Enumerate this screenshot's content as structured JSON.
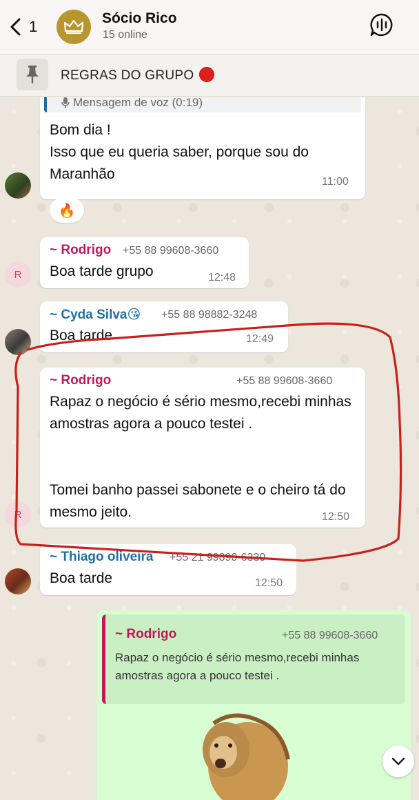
{
  "header": {
    "back_count": "1",
    "group_name": "Sócio Rico",
    "group_status": "15 online"
  },
  "pinned": {
    "label": "REGRAS DO GRUPO"
  },
  "messages": [
    {
      "quoted_preview": "Mensagem de voz (0:19)",
      "text": "Bom dia !\nIsso que eu queria saber, porque sou do Maranhão",
      "time": "11:00",
      "reaction": "🔥"
    },
    {
      "sender": "~ Rodrigo",
      "phone": "+55 88 99608-3660",
      "text": "Boa tarde grupo",
      "time": "12:48",
      "avatar_letter": "R"
    },
    {
      "sender": "~ Cyda Silva😘",
      "phone": "+55 88 98882-3248",
      "text": "Boa tarde",
      "time": "12:49"
    },
    {
      "sender": "~ Rodrigo",
      "phone": "+55 88 99608-3660",
      "text": "Rapaz o negócio é sério mesmo,recebi minhas amostras agora a pouco testei .\n\n\nTomei banho passei sabonete e o cheiro tá do mesmo jeito.",
      "time": "12:50",
      "avatar_letter": "R"
    },
    {
      "sender": "~ Thiago oliveira",
      "phone": "+55 21 99890-6330",
      "text": "Boa tarde",
      "time": "12:50"
    },
    {
      "quote_sender": "~ Rodrigo",
      "quote_phone": "+55 88 99608-3660",
      "quote_text": "Rapaz o negócio é sério mesmo,recebi minhas amostras agora a pouco testei ."
    }
  ],
  "colors": {
    "rodrigo": "#c2185b",
    "cyda": "#1e6fa8",
    "thiago": "#1e6fa8",
    "outgoing_bubble": "#d9fdd3",
    "annotation": "#c8201a"
  },
  "icons": [
    "back-icon",
    "crown-icon",
    "voice-chat-icon",
    "pin-icon",
    "mic-icon",
    "chevron-down-icon"
  ]
}
